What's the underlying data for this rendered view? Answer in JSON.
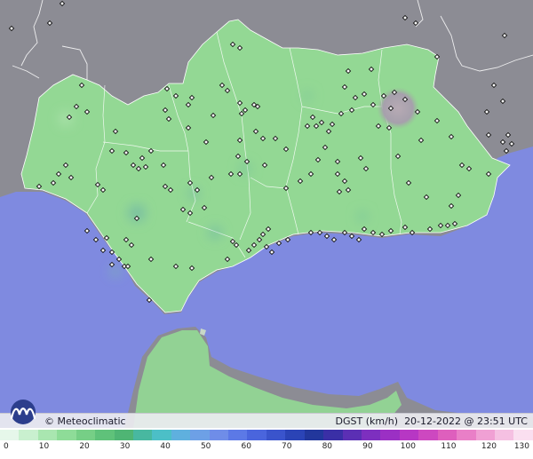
{
  "credit": "© Meteoclimatic",
  "product": {
    "variable": "DGST (km/h)",
    "timestamp": "20-12-2022 @ 23:51 UTC"
  },
  "scale": {
    "labels": [
      "0",
      "10",
      "20",
      "30",
      "40",
      "50",
      "60",
      "70",
      "80",
      "90",
      "100",
      "110",
      "120",
      "130"
    ],
    "colors": [
      "#e6f7ea",
      "#c9f0cf",
      "#a9e6b0",
      "#8edc98",
      "#76cf86",
      "#5fc27a",
      "#4fb574",
      "#48b8a0",
      "#4cbfc7",
      "#5fb0de",
      "#6da0e6",
      "#6f8de8",
      "#5c79e6",
      "#4a65dd",
      "#3a54cc",
      "#2b44b6",
      "#22379c",
      "#3a2fa6",
      "#5b2fb4",
      "#7d2fbf",
      "#9b30c4",
      "#b737c4",
      "#cd48c0",
      "#de5fbd",
      "#e97fc7",
      "#f0a0d4",
      "#f5c0e2",
      "#fadff0"
    ]
  },
  "colors": {
    "sea": "#7f8ae0",
    "land_other": "#8a8a92",
    "andalusia": "#93d894",
    "high_terrain": "#a89aa6"
  },
  "icons": {
    "logo": "meteoclimatic-wave-logo",
    "station": "station-marker-icon"
  }
}
